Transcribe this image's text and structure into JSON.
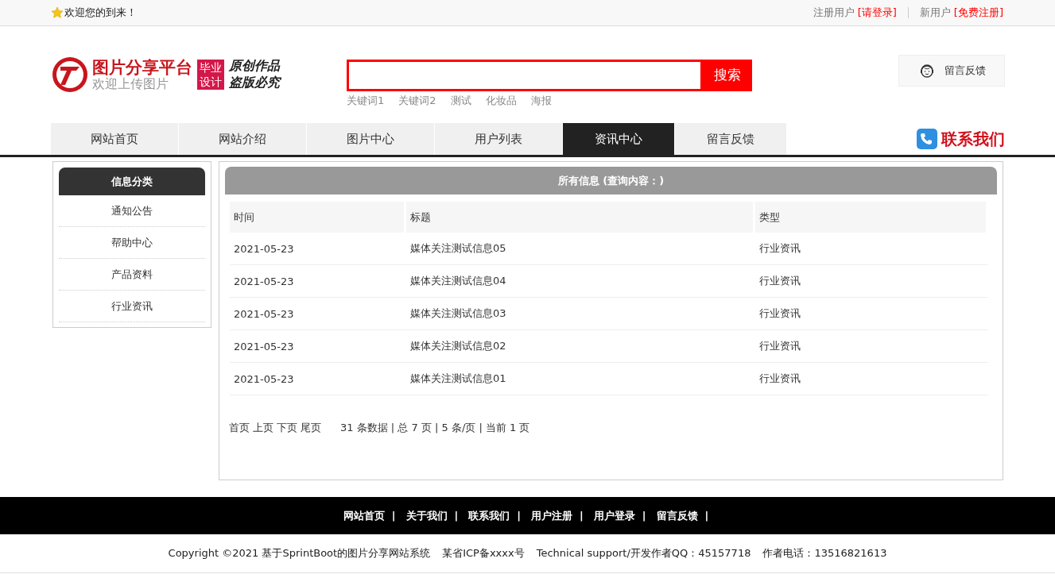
{
  "top_bar": {
    "welcome": "欢迎您的到来！",
    "login": {
      "prefix": "注册用户",
      "link": "[请登录]"
    },
    "register": {
      "prefix": "新用户",
      "link": "[免费注册]"
    }
  },
  "header": {
    "logo": {
      "title": "图片分享平台",
      "subtitle": "欢迎上传图片",
      "badge": [
        "毕业",
        "设计"
      ],
      "slogan": [
        "原创作品",
        "盗版必究"
      ]
    },
    "search": {
      "button": "搜索",
      "keywords": [
        "关键词1",
        "关键词2",
        "测试",
        "化妆品",
        "海报"
      ]
    },
    "feedback_button": "留言反馈"
  },
  "nav": {
    "items": [
      {
        "label": "网站首页",
        "selected": false
      },
      {
        "label": "网站介绍",
        "selected": false
      },
      {
        "label": "图片中心",
        "selected": false
      },
      {
        "label": "用户列表",
        "selected": false
      },
      {
        "label": "资讯中心",
        "selected": true
      },
      {
        "label": "留言反馈",
        "selected": false
      }
    ],
    "contact": "联系我们"
  },
  "sidebar": {
    "title": "信息分类",
    "items": [
      "通知公告",
      "帮助中心",
      "产品资料",
      "行业资讯"
    ]
  },
  "main": {
    "title": "所有信息 (查询内容：)",
    "table": {
      "columns": [
        "时间",
        "标题",
        "类型"
      ],
      "rows": [
        [
          "2021-05-23",
          "媒体关注测试信息05",
          "行业资讯"
        ],
        [
          "2021-05-23",
          "媒体关注测试信息04",
          "行业资讯"
        ],
        [
          "2021-05-23",
          "媒体关注测试信息03",
          "行业资讯"
        ],
        [
          "2021-05-23",
          "媒体关注测试信息02",
          "行业资讯"
        ],
        [
          "2021-05-23",
          "媒体关注测试信息01",
          "行业资讯"
        ]
      ]
    },
    "pager": {
      "links": [
        "首页",
        "上页",
        "下页",
        "尾页"
      ],
      "summary": "31 条数据 | 总 7 页 | 5 条/页 | 当前 1 页"
    }
  },
  "footer": {
    "links": [
      {
        "label": "网站首页",
        "separator": "|"
      },
      {
        "label": "关于我们",
        "separator": "|"
      },
      {
        "label": "联系我们",
        "separator": "|"
      },
      {
        "label": "用户注册",
        "separator": "|"
      },
      {
        "label": "用户登录",
        "separator": "|"
      },
      {
        "label": "留言反馈",
        "separator": "|"
      }
    ],
    "copyright": [
      "Copyright ©2021 基于SprintBoot的图片分享网站系统",
      "某省ICP备xxxx号",
      "Technical support/开发作者QQ：45157718",
      "作者电话：13516821613"
    ]
  }
}
